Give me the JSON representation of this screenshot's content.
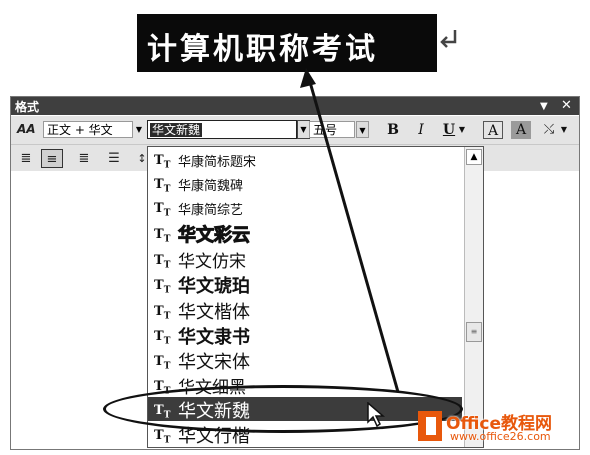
{
  "preview": {
    "text": "计算机职称考试"
  },
  "window": {
    "title": "格式",
    "dropdown_icon": "▼",
    "close_icon": "✕"
  },
  "toolbar": {
    "style_value": "正文 + 华文",
    "font_value": "华文新魏",
    "size_value": "五号",
    "bold_label": "B",
    "italic_label": "I",
    "underline_label": "U",
    "font_color_label": "A",
    "highlight_label": "A"
  },
  "font_list": {
    "items": [
      "华康简标题宋",
      "华康简魏碑",
      "华康简综艺",
      "华文彩云",
      "华文仿宋",
      "华文琥珀",
      "华文楷体",
      "华文隶书",
      "华文宋体",
      "华文细黑",
      "华文新魏",
      "华文行楷"
    ],
    "selected": "华文新魏"
  },
  "watermark": {
    "brand": "Office教程网",
    "url": "www.office26.com"
  },
  "colors": {
    "accent": "#e8580c",
    "titlebar": "#3f3f3f",
    "selection": "#3c3c3c"
  }
}
